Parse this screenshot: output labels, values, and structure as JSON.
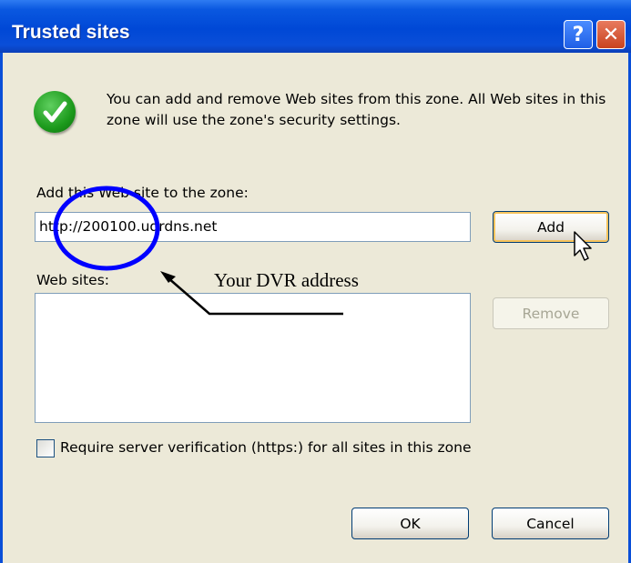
{
  "window": {
    "title": "Trusted sites",
    "help_glyph": "?",
    "close_glyph": "✕"
  },
  "info": {
    "icon": "check-icon",
    "text": "You can add and remove Web sites from this zone. All Web sites in this zone will use the zone's security settings."
  },
  "add_site": {
    "label": "Add this Web site to the zone:",
    "value": "http://200100.udrdns.net",
    "add_button": "Add"
  },
  "websites": {
    "label": "Web sites:",
    "items": [],
    "remove_button": "Remove"
  },
  "verification": {
    "label": "Require server verification (https:) for all sites in this zone",
    "checked": false
  },
  "footer": {
    "ok_button": "OK",
    "cancel_button": "Cancel"
  },
  "annotation": {
    "text": "Your DVR address",
    "circle_color": "#0000ff"
  },
  "colors": {
    "title_bar": "#0a4fd8",
    "dialog_bg": "#ece9d8",
    "add_button_focus": "#f6c35c"
  }
}
